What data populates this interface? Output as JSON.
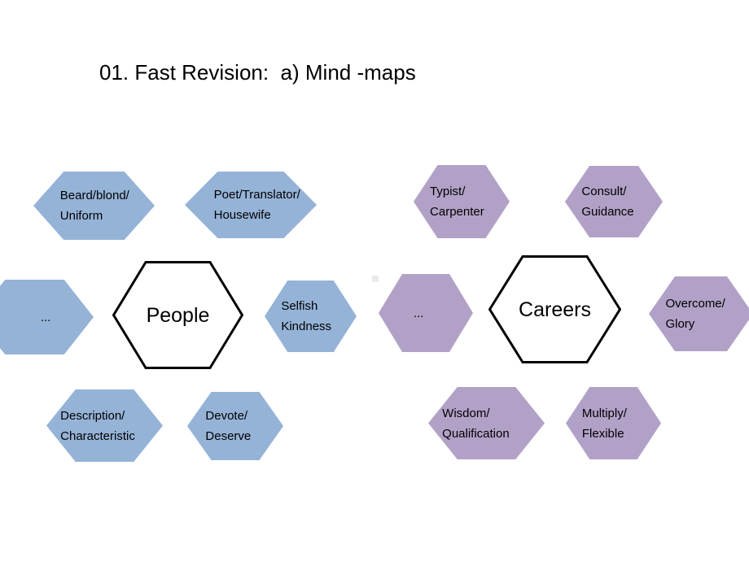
{
  "slide": {
    "title": "01. Fast Revision:  a) Mind -maps",
    "background": "#ffffff"
  },
  "colors": {
    "blue_fill": "#95b3d7",
    "purple_fill": "#b2a1c7",
    "center_fill": "#ffffff",
    "center_stroke": "#000000",
    "text": "#000000"
  },
  "mindmaps": [
    {
      "name": "people",
      "center_label": "People",
      "accent": "#95b3d7",
      "nodes": [
        {
          "id": "beard-blond-uniform",
          "label": "Beard/blond/\nUniform"
        },
        {
          "id": "poet-translator-housewife",
          "label": "Poet/Translator/\nHousewife"
        },
        {
          "id": "ellipsis-left-people",
          "label": "..."
        },
        {
          "id": "selfish-kindness",
          "label": "Selfish\nKindness"
        },
        {
          "id": "description-characteristic",
          "label": "Description/\nCharacteristic"
        },
        {
          "id": "devote-deserve",
          "label": "Devote/\nDeserve"
        }
      ]
    },
    {
      "name": "careers",
      "center_label": "Careers",
      "accent": "#b2a1c7",
      "nodes": [
        {
          "id": "typist-carpenter",
          "label": "Typist/\nCarpenter"
        },
        {
          "id": "consult-guidance",
          "label": "Consult/\nGuidance"
        },
        {
          "id": "ellipsis-left-careers",
          "label": "..."
        },
        {
          "id": "overcome-glory",
          "label": "Overcome/\nGlory"
        },
        {
          "id": "wisdom-qualification",
          "label": "Wisdom/\nQualification"
        },
        {
          "id": "multiply-flexible",
          "label": "Multiply/\nFlexible"
        }
      ]
    }
  ]
}
